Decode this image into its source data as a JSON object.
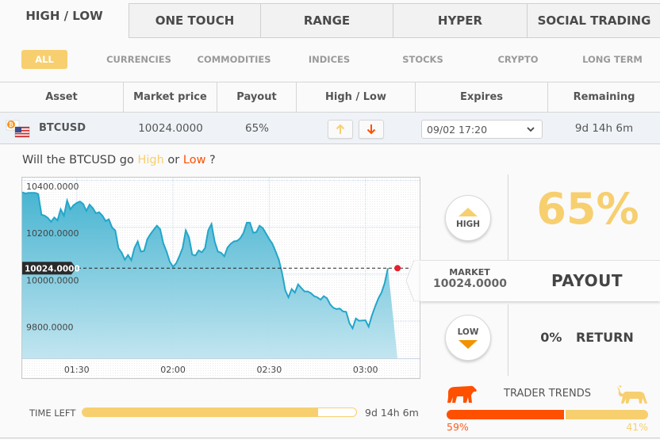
{
  "tabs": [
    {
      "label": "HIGH / LOW",
      "active": true
    },
    {
      "label": "ONE TOUCH",
      "active": false
    },
    {
      "label": "RANGE",
      "active": false
    },
    {
      "label": "HYPER",
      "active": false
    },
    {
      "label": "SOCIAL TRADING",
      "active": false
    }
  ],
  "categories": [
    {
      "label": "ALL",
      "active": true
    },
    {
      "label": "CURRENCIES",
      "active": false
    },
    {
      "label": "COMMODITIES",
      "active": false
    },
    {
      "label": "INDICES",
      "active": false
    },
    {
      "label": "STOCKS",
      "active": false
    },
    {
      "label": "CRYPTO",
      "active": false
    },
    {
      "label": "LONG TERM",
      "active": false
    }
  ],
  "table": {
    "headers": [
      "Asset",
      "Market price",
      "Payout",
      "High / Low",
      "Expires",
      "Remaining"
    ],
    "row": {
      "asset": "BTCUSD",
      "asset_icon": "bitcoin-usd-flag-icon",
      "market_price": "10024.0000",
      "payout": "65%",
      "high_icon": "arrow-up-icon",
      "low_icon": "arrow-down-icon",
      "expires": "09/02 17:20",
      "remaining": "9d 14h 6m"
    }
  },
  "question": {
    "prefix": "Will the BTCUSD go",
    "high": "High",
    "or": "or",
    "low": "Low",
    "suffix": "?"
  },
  "chart_data": {
    "type": "area",
    "title": "",
    "xlabel": "",
    "ylabel": "",
    "x_ticks": [
      "01:30",
      "02:00",
      "02:30",
      "03:00"
    ],
    "y_ticks": [
      "10400.0000",
      "10200.0000",
      "10000.0000",
      "9800.0000"
    ],
    "ylim": [
      9640,
      10410
    ],
    "xlim_minutes": [
      0,
      112
    ],
    "x_tick_minutes": [
      17,
      47,
      77,
      107
    ],
    "current_price_label": "10024.0000",
    "current_price": 10024,
    "grid": true,
    "series": [
      {
        "name": "BTCUSD",
        "x_minutes": [
          0,
          1,
          2,
          4,
          5,
          6,
          7,
          8,
          9,
          10,
          11,
          12,
          13,
          14,
          15,
          16,
          17,
          18,
          19,
          20,
          21,
          22,
          23,
          24,
          25,
          26,
          27,
          28,
          29,
          30,
          31,
          32,
          33,
          34,
          35,
          36,
          37,
          38,
          39,
          40,
          41,
          42,
          43,
          44,
          45,
          46,
          47,
          48,
          49,
          50,
          51,
          52,
          53,
          54,
          55,
          56,
          57,
          58,
          59,
          60,
          61,
          62,
          63,
          64,
          65,
          66,
          67,
          68,
          69,
          70,
          71,
          72,
          73,
          74,
          75,
          76,
          77,
          78,
          79,
          80,
          81,
          82,
          83,
          84,
          85,
          86,
          87,
          88,
          89,
          90,
          91,
          92,
          93,
          94,
          95,
          96,
          97,
          98,
          99,
          100,
          101,
          102,
          103,
          104,
          105,
          106,
          107,
          108,
          109,
          110,
          111,
          112,
          113,
          114,
          115,
          116,
          116.5,
          117
        ],
        "values": [
          10348,
          10342,
          10345,
          10345,
          10340,
          10252,
          10248,
          10238,
          10222,
          10240,
          10228,
          10275,
          10248,
          10312,
          10275,
          10292,
          10302,
          10308,
          10298,
          10268,
          10295,
          10280,
          10258,
          10262,
          10248,
          10225,
          10232,
          10198,
          10185,
          10110,
          10090,
          10060,
          10080,
          10058,
          10110,
          10138,
          10095,
          10098,
          10148,
          10170,
          10188,
          10205,
          10190,
          10130,
          10095,
          10052,
          10030,
          10045,
          10075,
          10110,
          10185,
          10155,
          10082,
          10078,
          10100,
          10092,
          10110,
          10185,
          10212,
          10138,
          10095,
          10090,
          10075,
          10112,
          10128,
          10138,
          10140,
          10152,
          10175,
          10218,
          10218,
          10175,
          10178,
          10205,
          10195,
          10172,
          10148,
          10128,
          10095,
          10060,
          10005,
          9930,
          9900,
          9935,
          9920,
          9955,
          9940,
          9925,
          9925,
          9918,
          9905,
          9900,
          9890,
          9905,
          9896,
          9870,
          9855,
          9850,
          9852,
          9840,
          9838,
          9790,
          9768,
          9810,
          9800,
          9801,
          9802,
          9775,
          9822,
          9860,
          9895,
          9920,
          9960,
          10024
        ]
      }
    ]
  },
  "right_panel": {
    "high_label": "HIGH",
    "low_label": "LOW",
    "payout_percent": "65%",
    "market_label": "MARKET",
    "market_value": "10024.0000",
    "payout_label": "PAYOUT",
    "return_percent": "0%",
    "return_label": "RETURN",
    "trader_trends_label": "TRADER TRENDS",
    "bear_percent_value": 59,
    "bull_percent_value": 41,
    "bear_percent": "59%",
    "bull_percent": "41%"
  },
  "time_left": {
    "label": "TIME LEFT",
    "value": "9d 14h 6m",
    "fraction": 0.86
  },
  "colors": {
    "accent_yellow": "#f7cf6f",
    "accent_orange": "#ff5000",
    "low_orange": "#f39200",
    "chart_line": "#23a6c9",
    "current_dot": "#e5202f"
  }
}
